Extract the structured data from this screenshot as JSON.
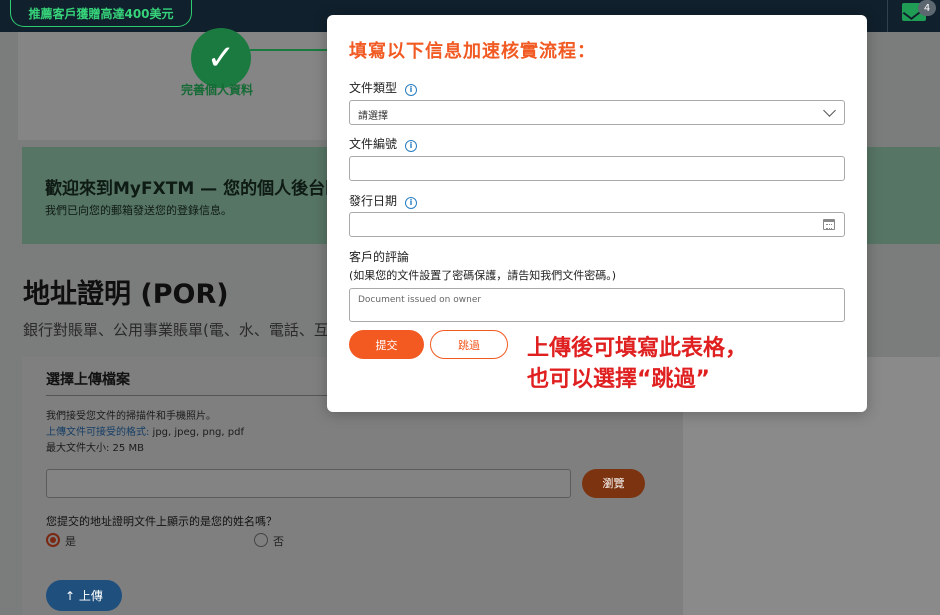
{
  "topbar": {
    "promo": "推薦客戶獲贈高達400美元",
    "notification_count": "4"
  },
  "stepper": {
    "completed_step_label": "完善個人資料"
  },
  "welcome": {
    "title": "歡迎來到MyFXTM — 您的個人後台區",
    "subtitle": "我們已向您的郵箱發送您的登錄信息。"
  },
  "por": {
    "title": "地址證明 (POR)",
    "description": "銀行對賬單、公用事業賬單(電、水、電話、互"
  },
  "upload": {
    "heading": "選擇上傳檔案",
    "info_line1": "我們接受您文件的掃描件和手機照片。",
    "formats_label": "上傳文件可接受的格式:",
    "formats_value": " jpg, jpeg, png, pdf",
    "max_size": "最大文件大小: 25 MB",
    "browse_label": "瀏覽",
    "name_question": "您提交的地址證明文件上顯示的是您的姓名嗎？",
    "options": [
      {
        "label": "是",
        "selected": true
      },
      {
        "label": "否",
        "selected": false
      }
    ],
    "upload_button": "上傳"
  },
  "modal": {
    "title": "填寫以下信息加速核實流程：",
    "doc_type_label": "文件類型",
    "doc_type_value": "請選擇",
    "doc_number_label": "文件編號",
    "issue_date_label": "發行日期",
    "comment_label": "客戶的評論",
    "comment_hint": "(如果您的文件設置了密碼保護，請告知我們文件密碼。)",
    "comment_value": "Document issued on owner",
    "submit_label": "提交",
    "skip_label": "跳過"
  },
  "annotation": {
    "line1": "上傳後可填寫此表格，",
    "line2": "也可以選擇“跳過”"
  },
  "colors": {
    "accent_orange": "#f15a22",
    "annotation_red": "#e02020",
    "success_green": "#1a7a3f",
    "info_blue": "#2a7ec1"
  },
  "icons": [
    "checkmark-icon",
    "mail-icon",
    "info-icon",
    "chevron-down-icon",
    "calendar-icon",
    "upload-arrow-icon"
  ]
}
